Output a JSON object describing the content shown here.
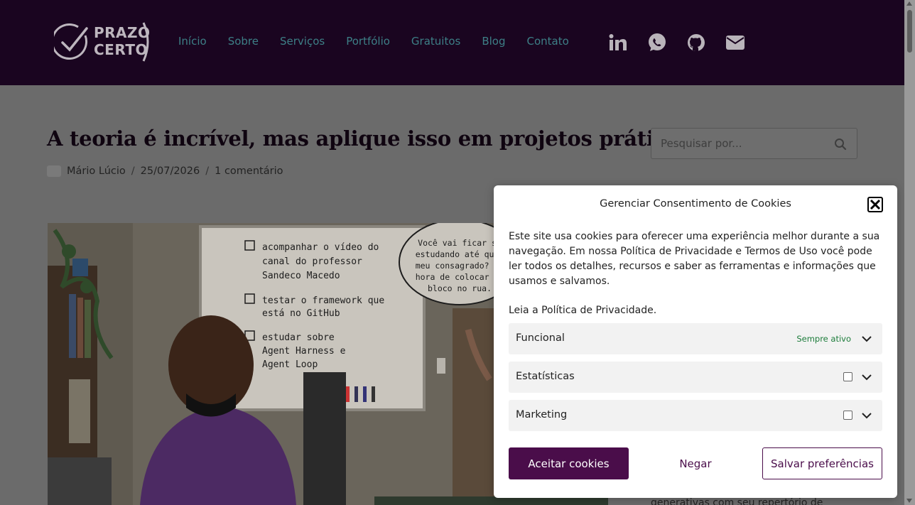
{
  "header": {
    "logo_line1": "PRAZO",
    "logo_line2": "CERTO",
    "nav": [
      "Início",
      "Sobre",
      "Serviços",
      "Portfólio",
      "Gratuitos",
      "Blog",
      "Contato"
    ],
    "social_icons": [
      "linkedin-icon",
      "whatsapp-icon",
      "github-icon",
      "email-icon"
    ]
  },
  "article": {
    "title": "A teoria é incrível, mas aplique isso em projetos práticos",
    "author": "Mário Lúcio",
    "date": "25/07/2026",
    "comments": "1 comentário",
    "separator": "/"
  },
  "hero_image": {
    "whiteboard_items": [
      "acompanhar o vídeo do canal do professor Sandeco Macedo",
      "testar o framework que está no GitHub",
      "estudar sobre Agent Harness e Agent Loop"
    ],
    "speech_bubble": "Você vai ficar só estudando até quan meu consagrado? Tá hora de colocar se bloco no rua."
  },
  "search": {
    "placeholder": "Pesquisar por..."
  },
  "sidebar": {
    "partial_text": "generativas com seu repertório de"
  },
  "cookie": {
    "title": "Gerenciar Consentimento de Cookies",
    "body": "Este site usa cookies para oferecer uma experiência melhor durante a sua navegação. Em nossa Política de Privacidade e Termos de Uso você pode ler todos os detalhes, recursos e saber as ferramentas e informações que usamos e salvamos.",
    "link_text": "Leia a Política de Privacidade.",
    "categories": [
      {
        "label": "Funcional",
        "status": "Sempre ativo"
      },
      {
        "label": "Estatísticas"
      },
      {
        "label": "Marketing"
      }
    ],
    "accept": "Aceitar cookies",
    "deny": "Negar",
    "save": "Salvar preferências"
  },
  "colors": {
    "header_bg": "#1a0520",
    "nav_link": "#3d7f86",
    "accent": "#4a0d4a",
    "always_active": "#1c7c3a"
  }
}
